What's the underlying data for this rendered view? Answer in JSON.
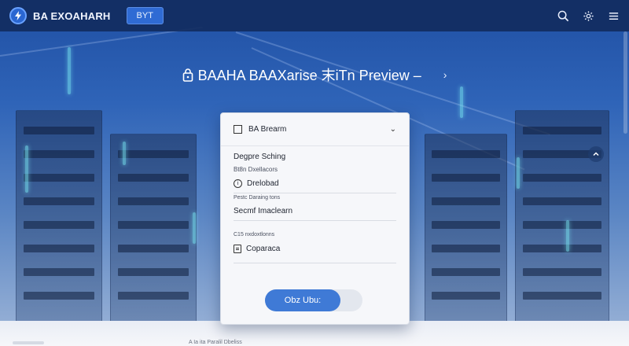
{
  "app": {
    "brand": "BA EXOAHARH",
    "badge": "BYT"
  },
  "hero": {
    "title": "BAAHA BAAXarise 末iTn Preview –",
    "chevron": "›"
  },
  "card": {
    "header": "BA Brearm",
    "rows": {
      "r1": "Degpre Sching",
      "r2": "Bt8n Dxellacors",
      "r3": "Drelobad",
      "r4": "Pestc Daraing tons",
      "r5": "Secmf Imaclearn",
      "r6": "C15 nxdoxtlonns",
      "r7": "Coparaca"
    },
    "cta_label": "Obz Ubu:"
  },
  "footer": {
    "text": "A Ia ita Paralil Dbeliss"
  },
  "colors": {
    "topbar": "#122d5f",
    "accent": "#3f7ad6",
    "card_bg": "#f6f7fa"
  },
  "icons": {
    "logo": "bolt-logo-icon",
    "search": "search-icon",
    "settings": "gear-icon",
    "menu": "menu-icon",
    "lock": "lock-icon",
    "info": "info-icon",
    "document": "document-icon",
    "chevron_up": "chevron-up-icon",
    "chevron_down": "chevron-down-icon"
  }
}
